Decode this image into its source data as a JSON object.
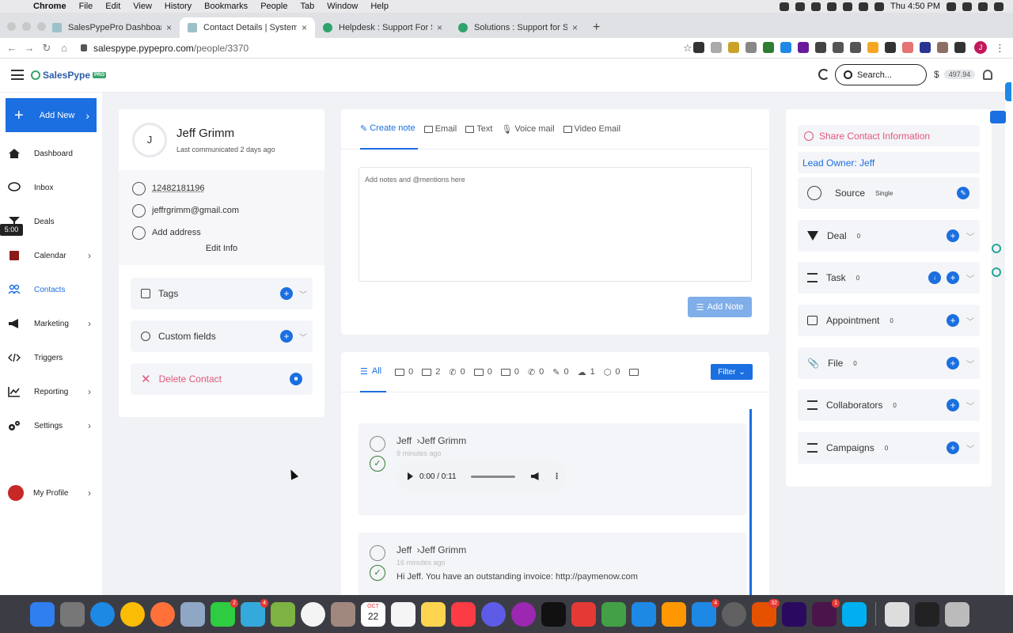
{
  "menubar": {
    "app": "Chrome",
    "items": [
      "File",
      "Edit",
      "View",
      "History",
      "Bookmarks",
      "People",
      "Tab",
      "Window",
      "Help"
    ],
    "clock": "Thu 4:50 PM"
  },
  "browser": {
    "tabs": [
      {
        "title": "SalesPypePro Dashboard | Das",
        "favicon": "salespype",
        "active": false
      },
      {
        "title": "Contact Details | System Agen",
        "favicon": "salespype",
        "active": true
      },
      {
        "title": "Helpdesk : Support For SalesP",
        "favicon": "helpdesk",
        "active": false
      },
      {
        "title": "Solutions : Support for SalesPy",
        "favicon": "helpdesk",
        "active": false
      }
    ],
    "url_host": "salespype.pypepro.com",
    "url_path": "/people/3370",
    "profile_initial": "J"
  },
  "header": {
    "logo": "SalesPype",
    "logo_tag": "PRO",
    "search_placeholder": "Search...",
    "currency": "$",
    "balance": "497.94"
  },
  "sidebar": {
    "add_new": "Add New",
    "timer": "5:00",
    "items": [
      {
        "label": "Dashboard",
        "icon": "home-icon",
        "chevron": false,
        "active": false
      },
      {
        "label": "Inbox",
        "icon": "chat-icon",
        "chevron": false,
        "active": false
      },
      {
        "label": "Deals",
        "icon": "funnel-icon",
        "chevron": false,
        "active": false
      },
      {
        "label": "Calendar",
        "icon": "calendar-icon",
        "chevron": true,
        "active": false
      },
      {
        "label": "Contacts",
        "icon": "people-icon",
        "chevron": false,
        "active": true
      },
      {
        "label": "Marketing",
        "icon": "megaphone-icon",
        "chevron": true,
        "active": false
      },
      {
        "label": "Triggers",
        "icon": "code-icon",
        "chevron": false,
        "active": false
      },
      {
        "label": "Reporting",
        "icon": "chart-icon",
        "chevron": true,
        "active": false
      },
      {
        "label": "Settings",
        "icon": "gears-icon",
        "chevron": true,
        "active": false
      }
    ],
    "profile": "My Profile"
  },
  "contact": {
    "initial": "J",
    "name": "Jeff Grimm",
    "last_communicated": "Last communicated 2 days ago",
    "phone": "12482181196",
    "email": "jeffrgrimm@gmail.com",
    "address": "Add address",
    "edit_info": "Edit Info",
    "tags": "Tags",
    "custom_fields": "Custom fields",
    "delete": "Delete Contact"
  },
  "note": {
    "tabs": [
      "Create note",
      "Email",
      "Text",
      "Voice mail",
      "Video Email"
    ],
    "placeholder": "Add notes and @mentions here",
    "add_button": "Add Note"
  },
  "activity": {
    "all_label": "All",
    "counts": [
      "0",
      "2",
      "0",
      "0",
      "0",
      "0",
      "0",
      "1",
      "0"
    ],
    "filter": "Filter",
    "entries": [
      {
        "from": "Jeff",
        "to": "Jeff Grimm",
        "time": "9 minutes ago",
        "audio_time": "0:00 / 0:11"
      },
      {
        "from": "Jeff",
        "to": "Jeff Grimm",
        "time": "16 minutes ago",
        "body": "Hi Jeff. You have an outstanding invoice: http://paymenow.com"
      }
    ]
  },
  "right_panel": {
    "share": "Share Contact Information",
    "lead_owner": "Lead Owner: Jeff",
    "source": {
      "label": "Source",
      "value": "Single"
    },
    "sections": [
      {
        "label": "Deal",
        "count": "0"
      },
      {
        "label": "Task",
        "count": "0"
      },
      {
        "label": "Appointment",
        "count": "0"
      },
      {
        "label": "File",
        "count": "0"
      },
      {
        "label": "Collaborators",
        "count": "0"
      },
      {
        "label": "Campaigns",
        "count": "0"
      }
    ]
  },
  "dock": {
    "badges": {
      "facetime": "2",
      "messages": "4",
      "appstore": "4",
      "classic": "32",
      "slack": "1"
    },
    "calendar_month": "OCT",
    "calendar_day": "22"
  }
}
